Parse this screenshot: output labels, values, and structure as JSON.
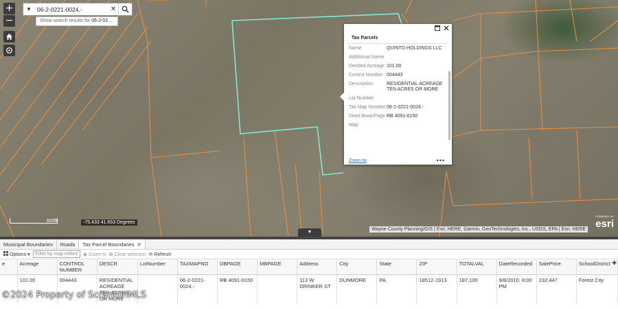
{
  "map": {
    "search": {
      "value": "06-2-0221-0024.-",
      "suggestion_prefix": "Show search results for ",
      "suggestion_term": "06-2-02..."
    },
    "zoom_in": "+",
    "zoom_out": "−",
    "scale_label": "600ft",
    "coordinates": "-75.433 41.653 Degrees",
    "attribution": "Wayne County Planning/GIS | Esri, HERE, Garmin, GeoTechnologies, Inc., USGS, EPA | Esri, HERE",
    "esri_logo": "esri",
    "esri_powered": "POWERED BY",
    "collapse_icon": "▼"
  },
  "popup": {
    "title": "Tax Parcels",
    "fields": [
      {
        "label": "Name",
        "value": "QUINTO HOLDINGS LLC"
      },
      {
        "label": "Additional Name",
        "value": ""
      },
      {
        "label": "Deeded Acreage",
        "value": "101.00"
      },
      {
        "label": "Control Number",
        "value": "004443"
      },
      {
        "label": "Description",
        "value": "RESIDENTIAL ACREAGE TEN ACRES OR MORE"
      },
      {
        "label": "Lot Number",
        "value": ""
      },
      {
        "label": "Tax Map Number",
        "value": "06-2-0221-0024.-"
      },
      {
        "label": "Deed Book/Page",
        "value": "RB 4091-0150"
      },
      {
        "label": "Map",
        "value": ""
      }
    ],
    "zoom_to": "Zoom to",
    "more": "•••"
  },
  "panel": {
    "tabs": [
      {
        "label": "Municipal Boundaries"
      },
      {
        "label": "Roads"
      },
      {
        "label": "Tax Parcel Boundaries",
        "close": "✕"
      }
    ],
    "toolbar": {
      "options": "Options",
      "filter": "Filter by map extent",
      "zoom_to": "Zoom to",
      "clear": "Clear selection",
      "refresh": "Refresh"
    },
    "columns": [
      "e",
      "Acreage",
      "CONTROL NUMBER",
      "DESCR",
      "LotNumber",
      "TAXMAPNO",
      "DBPAGE",
      "MBPAGE",
      "Address",
      "City",
      "State",
      "ZIP",
      "TOTALVAL",
      "DateRecorded",
      "SalePrice",
      "SchoolDistrict"
    ],
    "row": [
      "",
      "101.00",
      "004443",
      "RESIDENTIAL ACREAGE TEN ACRES OR MORE",
      "",
      "06-2-0221-0024.-",
      "RB 4091-0150",
      "",
      "113 W DRINKER ST",
      "DUNMORE",
      "PA",
      "18512-1913",
      "187,100",
      "9/8/2010, 8:00 PM",
      "232,447",
      "Forest City"
    ]
  },
  "watermark": "©2024 Property of ScrantonMLS"
}
